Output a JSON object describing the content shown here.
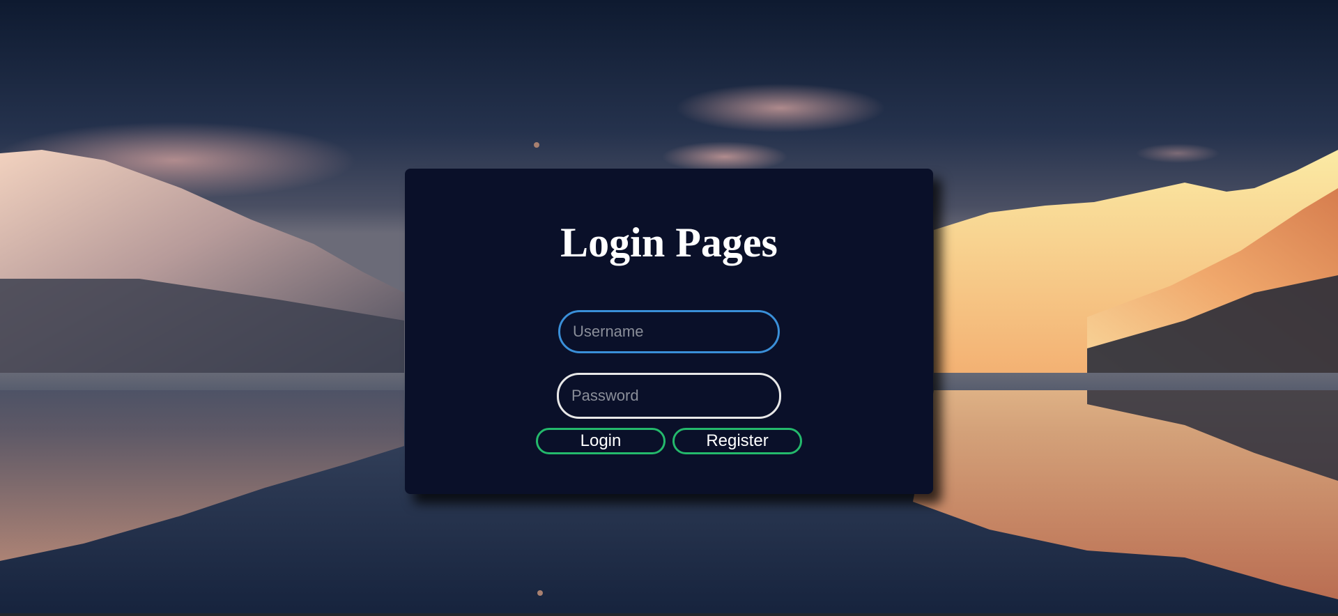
{
  "page": {
    "title": "Login Pages"
  },
  "form": {
    "username_placeholder": "Username",
    "password_placeholder": "Password",
    "login_label": "Login",
    "register_label": "Register"
  },
  "colors": {
    "card_background": "#0a1029",
    "username_border": "#3a8fd8",
    "password_border": "#e8e8e8",
    "button_border": "#24b96c",
    "text": "#ffffff"
  }
}
